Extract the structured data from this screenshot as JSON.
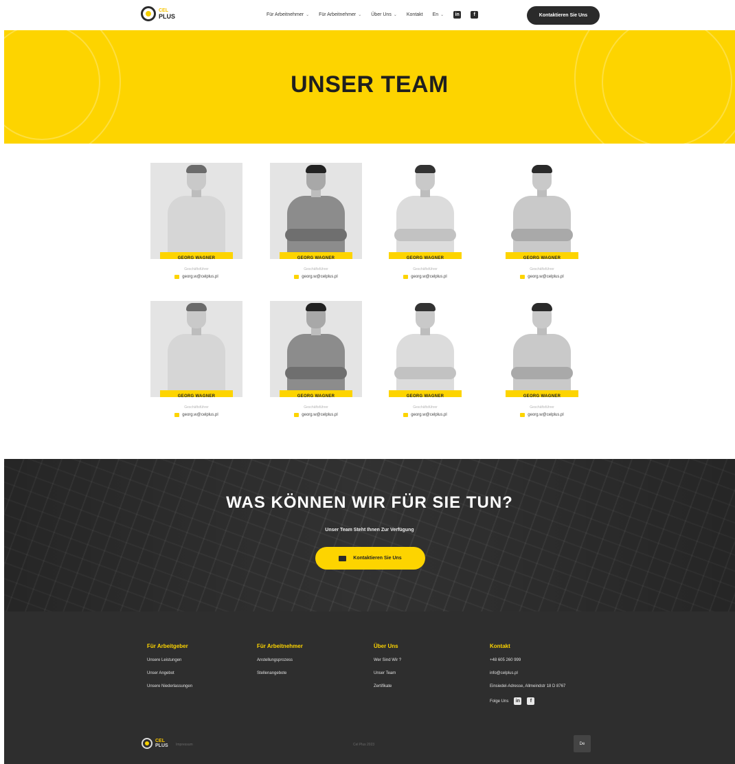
{
  "header": {
    "logo_top": "CEL",
    "logo_bottom": "PLUS",
    "menu": [
      {
        "label": "Für Arbeitnehmer",
        "has_dropdown": true
      },
      {
        "label": "Für Arbeitnehmer",
        "has_dropdown": true
      },
      {
        "label": "Über Uns",
        "has_dropdown": true
      },
      {
        "label": "Kontakt",
        "has_dropdown": false
      },
      {
        "label": "En",
        "has_dropdown": true
      }
    ],
    "social": [
      {
        "icon": "linkedin-icon",
        "glyph": "in"
      },
      {
        "icon": "facebook-icon",
        "glyph": "f"
      }
    ],
    "cta_label": "Kontaktieren Sie Uns"
  },
  "hero": {
    "title": "UNSER TEAM"
  },
  "team": {
    "members": [
      {
        "name": "GEORG WAGNER",
        "role": "Geschäftsführer",
        "email": "georg.w@celplus.pl"
      },
      {
        "name": "GEORG WAGNER",
        "role": "Geschäftsführer",
        "email": "georg.w@celplus.pl"
      },
      {
        "name": "GEORG WAGNER",
        "role": "Geschäftsführer",
        "email": "georg.w@celplus.pl"
      },
      {
        "name": "GEORG WAGNER",
        "role": "Geschäftsführer",
        "email": "georg.w@celplus.pl"
      },
      {
        "name": "GEORG WAGNER",
        "role": "Geschäftsführer",
        "email": "georg.w@celplus.pl"
      },
      {
        "name": "GEORG WAGNER",
        "role": "Geschäftsführer",
        "email": "georg.w@celplus.pl"
      },
      {
        "name": "GEORG WAGNER",
        "role": "Geschäftsführer",
        "email": "georg.w@celplus.pl"
      },
      {
        "name": "GEORG WAGNER",
        "role": "Geschäftsführer",
        "email": "georg.w@celplus.pl"
      }
    ]
  },
  "cta": {
    "title": "WAS KÖNNEN WIR FÜR SIE TUN?",
    "subtitle": "Unser Team Steht Ihnen Zur Verfügung",
    "button_label": "Kontaktieren Sie Uns"
  },
  "footer": {
    "columns": [
      {
        "title": "Für Arbeitgeber",
        "links": [
          "Unsere Leistungen",
          "Unser Angebot",
          "Unsere Niederlassungen"
        ]
      },
      {
        "title": "Für Arbeitnehmer",
        "links": [
          "Anstellungsprozess",
          "Stellenangebote"
        ]
      },
      {
        "title": "Über Uns",
        "links": [
          "Wer Sind Wir ?",
          "Unser Team",
          "Zertifikate"
        ]
      },
      {
        "title": "Kontakt",
        "links": [
          "+48 605 260 999",
          "info@celplus.pl",
          "Einsiedel-Adresse, Allmeindstr 18 D 8767"
        ]
      }
    ],
    "follow_label": "Folge Uns",
    "bottom_left": "Impressum",
    "bottom_center": "Cel Plus 2023",
    "language": "De"
  },
  "colors": {
    "accent": "#fdd400",
    "dark": "#2e2e2e"
  }
}
